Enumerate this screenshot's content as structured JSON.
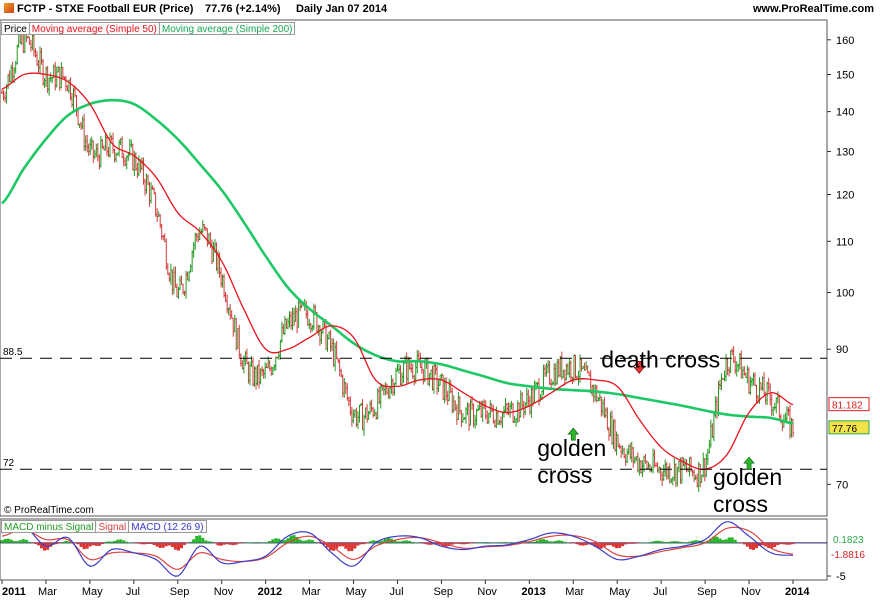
{
  "header": {
    "title": "FCTP - STXE Football EUR (Price)",
    "last": "77.76 (+2.14%)",
    "period": "Daily  Jan 07 2014",
    "site": "www.ProRealTime.com"
  },
  "legend_main": {
    "price": "Price",
    "ma50": "Moving average (Simple 50)",
    "ma200": "Moving average (Simple 200)"
  },
  "legend_macd": {
    "hist": "MACD minus Signal",
    "signal": "Signal",
    "macd": "MACD (12 26 9)"
  },
  "copyright": "© ProRealTime.com",
  "colors": {
    "price_up": "#1f9a1f",
    "price_down": "#d23c3c",
    "ma50": "#e8141e",
    "ma200": "#1ec864",
    "macd": "#3c3cc8",
    "signal": "#dc4646",
    "hist_pos": "#28b428",
    "hist_neg": "#dc3232"
  },
  "chart_data": [
    {
      "type": "line",
      "x_ticks": [
        "2011",
        "Mar",
        "May",
        "Jul",
        "Sep",
        "Nov",
        "2012",
        "Mar",
        "May",
        "Jul",
        "Sep",
        "Nov",
        "2013",
        "Mar",
        "May",
        "Jul",
        "Sep",
        "Nov",
        "2014"
      ],
      "y_ticks": [
        160,
        150,
        140,
        130,
        120,
        110,
        100,
        90,
        70
      ],
      "y_scale": "log",
      "ylim": [
        66,
        166
      ],
      "grid": false,
      "series": [
        {
          "name": "Price",
          "style": "ohlc",
          "x": [
            "2011-01",
            "2011-02",
            "2011-03",
            "2011-04",
            "2011-05",
            "2011-06",
            "2011-07",
            "2011-08",
            "2011-09",
            "2011-10",
            "2011-11",
            "2011-12",
            "2012-01",
            "2012-02",
            "2012-03",
            "2012-04",
            "2012-05",
            "2012-06",
            "2012-07",
            "2012-08",
            "2012-09",
            "2012-10",
            "2012-11",
            "2012-12",
            "2013-01",
            "2013-02",
            "2013-03",
            "2013-04",
            "2013-05",
            "2013-06",
            "2013-07",
            "2013-08",
            "2013-09",
            "2013-10",
            "2013-11",
            "2013-12",
            "2014-01"
          ],
          "values": [
            145,
            160,
            150,
            148,
            130,
            131,
            128,
            117,
            100,
            112,
            103,
            88,
            86,
            94,
            96,
            90,
            80,
            81,
            86,
            87,
            84,
            80,
            80,
            80,
            82,
            86,
            87,
            83,
            76,
            73,
            72,
            72,
            73,
            88,
            85,
            82,
            77.76
          ]
        },
        {
          "name": "Moving average (Simple 50)",
          "x": [
            "2011-01",
            "2011-02",
            "2011-03",
            "2011-04",
            "2011-05",
            "2011-06",
            "2011-07",
            "2011-08",
            "2011-09",
            "2011-10",
            "2011-11",
            "2011-12",
            "2012-01",
            "2012-02",
            "2012-03",
            "2012-04",
            "2012-05",
            "2012-06",
            "2012-07",
            "2012-08",
            "2012-09",
            "2012-10",
            "2012-11",
            "2012-12",
            "2013-01",
            "2013-02",
            "2013-03",
            "2013-04",
            "2013-05",
            "2013-06",
            "2013-07",
            "2013-08",
            "2013-09",
            "2013-10",
            "2013-11",
            "2013-12",
            "2014-01"
          ],
          "values": [
            146,
            150,
            150,
            148,
            142,
            132,
            129,
            124,
            116,
            112,
            106,
            97,
            90,
            90,
            92,
            94,
            92,
            85,
            84,
            85,
            85,
            83,
            81,
            80,
            81,
            83,
            85,
            85,
            84,
            79,
            75,
            73,
            72,
            74,
            80,
            83,
            81.182
          ]
        },
        {
          "name": "Moving average (Simple 200)",
          "x": [
            "2011-01",
            "2011-02",
            "2011-03",
            "2011-04",
            "2011-05",
            "2011-06",
            "2011-07",
            "2011-08",
            "2011-09",
            "2011-10",
            "2011-11",
            "2011-12",
            "2012-01",
            "2012-02",
            "2012-03",
            "2012-04",
            "2012-05",
            "2012-06",
            "2012-07",
            "2012-08",
            "2012-09",
            "2012-10",
            "2012-11",
            "2012-12",
            "2013-01",
            "2013-02",
            "2013-03",
            "2013-04",
            "2013-05",
            "2013-06",
            "2013-07",
            "2013-08",
            "2013-09",
            "2013-10",
            "2013-11",
            "2013-12",
            "2014-01"
          ],
          "values": [
            118,
            126,
            133,
            139,
            142,
            143,
            142,
            138,
            133,
            127,
            121,
            114,
            107,
            101,
            97,
            94,
            91,
            89,
            88,
            88,
            87.5,
            86.5,
            85.5,
            84.5,
            84,
            83.6,
            83.4,
            83.2,
            82.8,
            82.2,
            81.6,
            81,
            80.3,
            79.7,
            79.4,
            79.2,
            78.4
          ]
        }
      ],
      "reference_lines": [
        {
          "value": 88.5,
          "label": "88.5",
          "style": "dashed"
        },
        {
          "value": 72,
          "label": "72",
          "style": "dashed"
        }
      ],
      "last_values": [
        {
          "series": "Moving average (Simple 50)",
          "label": "81.182"
        },
        {
          "series": "Moving average (Simple 200)",
          "label": "77.76"
        }
      ],
      "annotations": [
        {
          "text": "golden\ncross",
          "x": "2013-03",
          "y": 76,
          "arrow": "up"
        },
        {
          "text": "death cross",
          "x": "2013-06",
          "y": 88,
          "arrow": "down"
        },
        {
          "text": "golden\ncross",
          "x": "2013-11",
          "y": 72,
          "arrow": "up"
        }
      ]
    },
    {
      "type": "line",
      "y_ticks": [
        -5
      ],
      "ylim": [
        -5.6,
        3.6
      ],
      "series": [
        {
          "name": "MACD (12 26 9)",
          "x": [
            "2011-01",
            "2011-02",
            "2011-03",
            "2011-04",
            "2011-05",
            "2011-06",
            "2011-07",
            "2011-08",
            "2011-09",
            "2011-10",
            "2011-11",
            "2011-12",
            "2012-01",
            "2012-02",
            "2012-03",
            "2012-04",
            "2012-05",
            "2012-06",
            "2012-07",
            "2012-08",
            "2012-09",
            "2012-10",
            "2012-11",
            "2012-12",
            "2013-01",
            "2013-02",
            "2013-03",
            "2013-04",
            "2013-05",
            "2013-06",
            "2013-07",
            "2013-08",
            "2013-09",
            "2013-10",
            "2013-11",
            "2013-12",
            "2014-01"
          ],
          "values": [
            1.5,
            2.5,
            -0.5,
            0.8,
            -3.5,
            -1,
            -1.5,
            -2.5,
            -5,
            -0.5,
            -3,
            -2.8,
            -2,
            1,
            1.5,
            -1.5,
            -3.5,
            0,
            1,
            0.8,
            -0.5,
            -1,
            -0.5,
            -0.3,
            0.5,
            1.5,
            1,
            -0.5,
            -2.5,
            -2,
            -1,
            -0.5,
            0.5,
            3.2,
            1,
            -1.5,
            -1.88
          ]
        },
        {
          "name": "Signal",
          "x": [
            "2011-01",
            "2011-02",
            "2011-03",
            "2011-04",
            "2011-05",
            "2011-06",
            "2011-07",
            "2011-08",
            "2011-09",
            "2011-10",
            "2011-11",
            "2011-12",
            "2012-01",
            "2012-02",
            "2012-03",
            "2012-04",
            "2012-05",
            "2012-06",
            "2012-07",
            "2012-08",
            "2012-09",
            "2012-10",
            "2012-11",
            "2012-12",
            "2013-01",
            "2013-02",
            "2013-03",
            "2013-04",
            "2013-05",
            "2013-06",
            "2013-07",
            "2013-08",
            "2013-09",
            "2013-10",
            "2013-11",
            "2013-12",
            "2014-01"
          ],
          "values": [
            1,
            2,
            0.5,
            0.5,
            -2.5,
            -1.5,
            -1.5,
            -2,
            -4,
            -1.5,
            -2.5,
            -2.8,
            -2.2,
            0,
            1,
            -0.5,
            -2.5,
            -0.5,
            0.5,
            0.8,
            0,
            -0.8,
            -0.6,
            -0.4,
            0.2,
            1,
            1.1,
            0.2,
            -1.8,
            -2,
            -1.3,
            -0.7,
            0,
            2.2,
            1.8,
            -0.8,
            -1.7
          ]
        },
        {
          "name": "MACD minus Signal",
          "style": "histogram",
          "x": [
            "2011-01",
            "2011-02",
            "2011-03",
            "2011-04",
            "2011-05",
            "2011-06",
            "2011-07",
            "2011-08",
            "2011-09",
            "2011-10",
            "2011-11",
            "2011-12",
            "2012-01",
            "2012-02",
            "2012-03",
            "2012-04",
            "2012-05",
            "2012-06",
            "2012-07",
            "2012-08",
            "2012-09",
            "2012-10",
            "2012-11",
            "2012-12",
            "2013-01",
            "2013-02",
            "2013-03",
            "2013-04",
            "2013-05",
            "2013-06",
            "2013-07",
            "2013-08",
            "2013-09",
            "2013-10",
            "2013-11",
            "2013-12",
            "2014-01"
          ],
          "values": [
            0.5,
            0.5,
            -1,
            0.3,
            -1,
            0.5,
            0,
            -0.5,
            -1,
            1,
            -0.5,
            0,
            0.2,
            1,
            0.5,
            -1,
            -1,
            0.5,
            0.5,
            0,
            -0.5,
            -0.2,
            0.1,
            0.1,
            0.3,
            0.5,
            -0.1,
            -0.7,
            -0.7,
            0,
            0.3,
            0.2,
            0.5,
            1,
            -0.8,
            -0.7,
            -0.18
          ]
        }
      ],
      "last_values": [
        {
          "series": "Signal",
          "label": "0.1823"
        },
        {
          "series": "MACD (12 26 9)",
          "label": "-1.8816"
        }
      ]
    }
  ]
}
